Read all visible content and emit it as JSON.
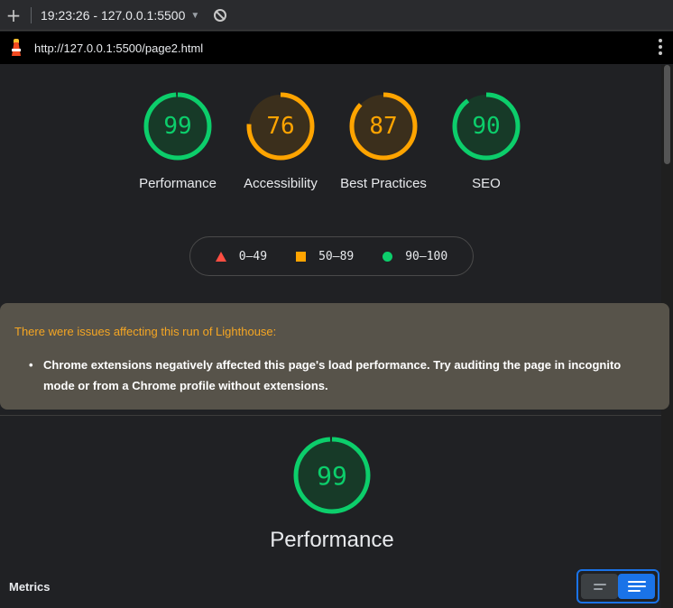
{
  "toolbar": {
    "plus_label": "+",
    "run_label": "19:23:26 - 127.0.0.1:5500",
    "dropdown_icon": "caret-down-icon",
    "clear_icon": "block-icon"
  },
  "urlbar": {
    "url": "http://127.0.0.1:5500/page2.html",
    "logo_icon": "lighthouse-icon",
    "menu_icon": "kebab-menu-icon"
  },
  "gauges": [
    {
      "label": "Performance",
      "score": "99",
      "value": 99,
      "color": "#0cce6b",
      "fill": "#173a28"
    },
    {
      "label": "Accessibility",
      "score": "76",
      "value": 76,
      "color": "#ffa400",
      "fill": "#3b2f1c"
    },
    {
      "label": "Best Practices",
      "score": "87",
      "value": 87,
      "color": "#ffa400",
      "fill": "#3b2f1c"
    },
    {
      "label": "SEO",
      "score": "90",
      "value": 90,
      "color": "#0cce6b",
      "fill": "#173a28"
    }
  ],
  "legend": {
    "fail": "0–49",
    "average": "50–89",
    "pass": "90–100",
    "colors": {
      "fail": "#ff4e42",
      "average": "#ffa400",
      "pass": "#0cce6b"
    }
  },
  "warning": {
    "title": "There were issues affecting this run of Lighthouse:",
    "items": [
      "Chrome extensions negatively affected this page's load performance. Try auditing the page in incognito mode or from a Chrome profile without extensions."
    ]
  },
  "category": {
    "title": "Performance",
    "score": "99",
    "value": 99,
    "color": "#0cce6b"
  },
  "metrics": {
    "heading": "Metrics",
    "view_toggle": {
      "selected": "expanded"
    }
  }
}
